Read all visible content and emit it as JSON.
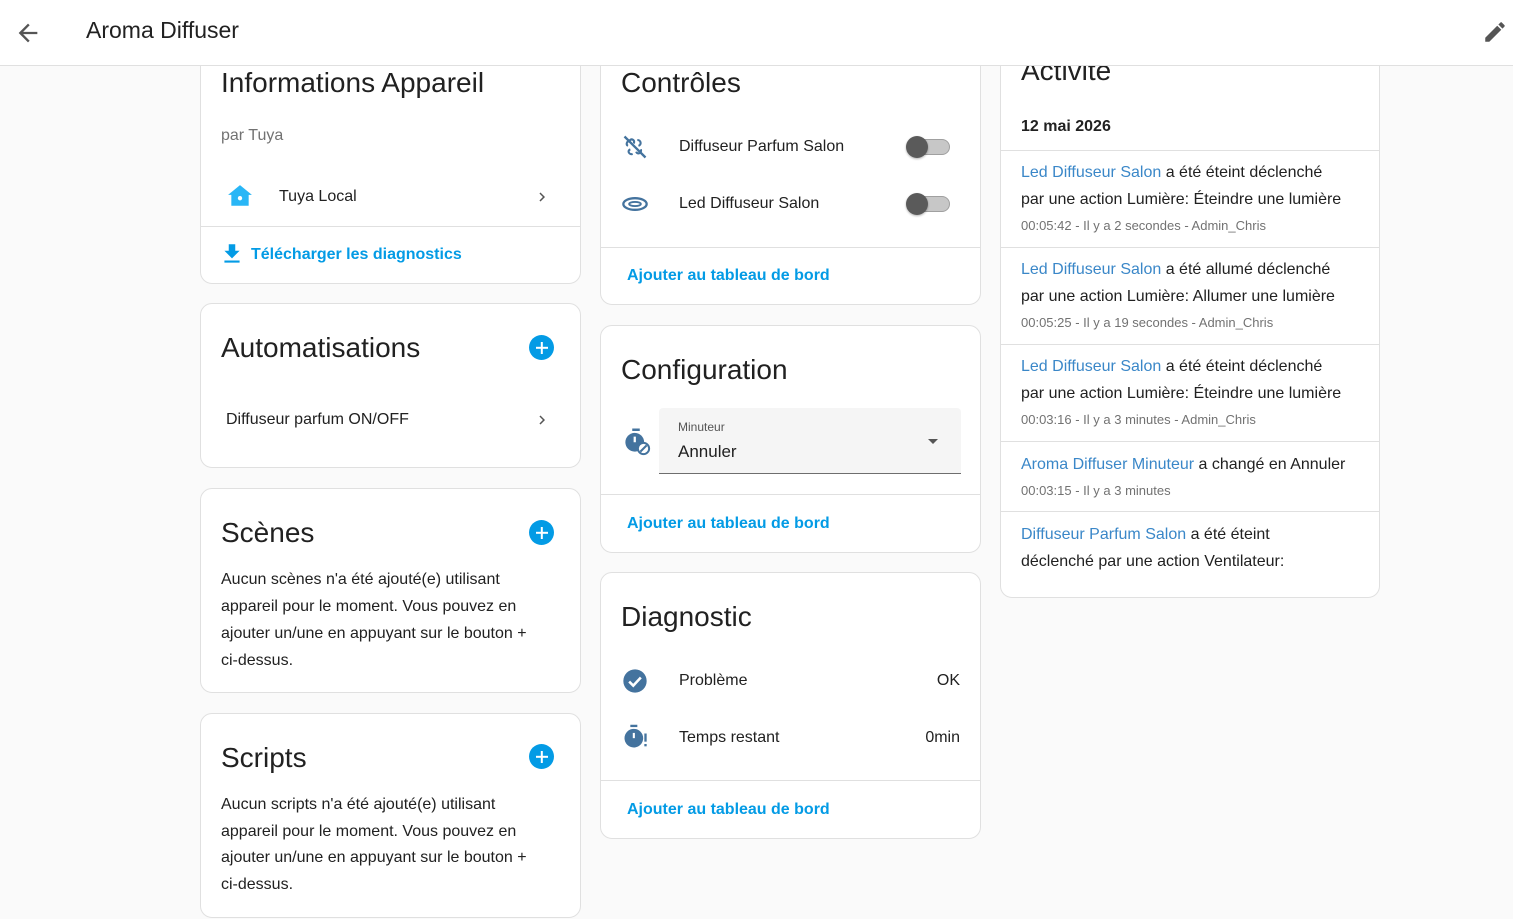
{
  "header": {
    "title": "Aroma Diffuser"
  },
  "colors": {
    "accent": "#039be5",
    "entity_link": "#3a87c8",
    "icon": "#44739e"
  },
  "device_info": {
    "title": "Informations Appareil",
    "manufacturer": "par Tuya",
    "integration": "Tuya Local",
    "download_label": "Télécharger les diagnostics"
  },
  "automations": {
    "title": "Automatisations",
    "items": [
      "Diffuseur parfum ON/OFF"
    ]
  },
  "scenes": {
    "title": "Scènes",
    "empty_lines": [
      "Aucun scènes n'a été ajouté(e) utilisant",
      "appareil pour le moment. Vous pouvez en",
      "ajouter un/une en appuyant sur le bouton +",
      "ci-dessus."
    ]
  },
  "scripts": {
    "title": "Scripts",
    "empty_lines": [
      "Aucun scripts n'a été ajouté(e) utilisant",
      "appareil pour le moment. Vous pouvez en",
      "ajouter un/une en appuyant sur le bouton +",
      "ci-dessus."
    ]
  },
  "controls": {
    "title": "Contrôles",
    "items": [
      {
        "label": "Diffuseur Parfum Salon",
        "icon": "fan-off-icon",
        "on": false
      },
      {
        "label": "Led Diffuseur Salon",
        "icon": "ring-light-icon",
        "on": false
      }
    ],
    "add_label": "Ajouter au tableau de bord"
  },
  "configuration": {
    "title": "Configuration",
    "select_label": "Minuteur",
    "select_value": "Annuler",
    "icon": "timer-cancel-icon",
    "add_label": "Ajouter au tableau de bord"
  },
  "diagnostic": {
    "title": "Diagnostic",
    "items": [
      {
        "label": "Problème",
        "value": "OK",
        "icon": "check-circle-icon"
      },
      {
        "label": "Temps restant",
        "value": "0min",
        "icon": "timer-alert-icon"
      }
    ],
    "add_label": "Ajouter au tableau de bord"
  },
  "activity": {
    "title": "Activité",
    "date": "12 mai 2026",
    "entries": [
      {
        "entity": "Led Diffuseur Salon",
        "line1_rest": " a été éteint déclenché",
        "line2": "par une action Lumière: Éteindre une lumière",
        "meta": "00:05:42 - Il y a 2 secondes - Admin_Chris"
      },
      {
        "entity": "Led Diffuseur Salon",
        "line1_rest": " a été allumé déclenché",
        "line2": "par une action Lumière: Allumer une lumière",
        "meta": "00:05:25 - Il y a 19 secondes - Admin_Chris"
      },
      {
        "entity": "Led Diffuseur Salon",
        "line1_rest": " a été éteint déclenché",
        "line2": "par une action Lumière: Éteindre une lumière",
        "meta": "00:03:16 - Il y a 3 minutes - Admin_Chris"
      },
      {
        "entity": "Aroma Diffuser Minuteur",
        "line1_rest": " a changé en Annuler",
        "line2": "",
        "meta": "00:03:15 - Il y a 3 minutes"
      },
      {
        "entity": "Diffuseur Parfum Salon",
        "line1_rest": " a été éteint",
        "line2": "déclenché par une action Ventilateur:",
        "meta": ""
      }
    ]
  }
}
